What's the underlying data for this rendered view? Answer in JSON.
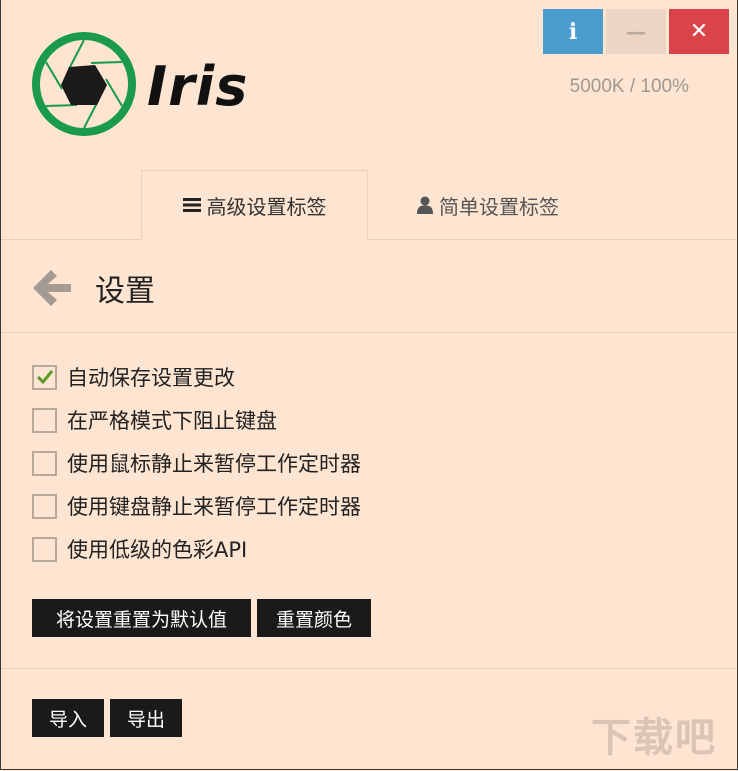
{
  "window_controls": {
    "info_label": "i",
    "minimize_label": "—",
    "close_label": "✕"
  },
  "app": {
    "name": "Iris",
    "status": "5000K / 100%"
  },
  "tabs": [
    {
      "label": "高级设置标签",
      "icon": "menu-icon",
      "active": true
    },
    {
      "label": "简单设置标签",
      "icon": "user-icon",
      "active": false
    }
  ],
  "section": {
    "title": "设置"
  },
  "options": [
    {
      "label": "自动保存设置更改",
      "checked": true
    },
    {
      "label": "在严格模式下阻止键盘",
      "checked": false
    },
    {
      "label": "使用鼠标静止来暂停工作定时器",
      "checked": false
    },
    {
      "label": "使用键盘静止来暂停工作定时器",
      "checked": false
    },
    {
      "label": "使用低级的色彩API",
      "checked": false
    }
  ],
  "buttons": {
    "reset_settings": "将设置重置为默认值",
    "reset_color": "重置颜色",
    "import": "导入",
    "export": "导出"
  },
  "watermark": "下载吧",
  "colors": {
    "background": "#fde5d1",
    "info": "#4a9ccc",
    "close": "#d9444a",
    "logo_green": "#1a9a4a",
    "check_green": "#5a9a2a"
  }
}
